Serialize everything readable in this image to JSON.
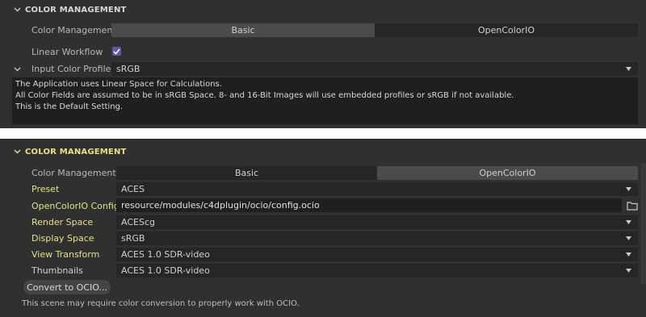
{
  "top_panel": {
    "title": "COLOR MANAGEMENT",
    "color_management_label": "Color Management",
    "modes": [
      "Basic",
      "OpenColorIO"
    ],
    "active_mode": "Basic",
    "linear_workflow_label": "Linear Workflow",
    "linear_workflow_checked": true,
    "input_profile_label": "Input Color Profile",
    "input_profile_value": "sRGB",
    "description": [
      "The Application uses Linear Space for Calculations.",
      "All Color Fields are assumed to be in sRGB Space. 8- and 16-Bit Images will use embedded profiles or sRGB if not available.",
      "This is the Default Setting."
    ]
  },
  "bottom_panel": {
    "title": "COLOR MANAGEMENT",
    "color_management_label": "Color Management",
    "modes": [
      "Basic",
      "OpenColorIO"
    ],
    "active_mode": "OpenColorIO",
    "preset_label": "Preset",
    "preset_value": "ACES",
    "config_label": "OpenColorIO Config",
    "config_value": "resource/modules/c4dplugin/ocio/config.ocio",
    "render_space_label": "Render Space",
    "render_space_value": "ACEScg",
    "display_space_label": "Display Space",
    "display_space_value": "sRGB",
    "view_transform_label": "View Transform",
    "view_transform_value": "ACES 1.0 SDR-video",
    "thumbnails_label": "Thumbnails",
    "thumbnails_value": "ACES 1.0 SDR-video",
    "convert_button": "Convert to OCIO...",
    "note": "This scene may require color conversion to properly work with OCIO."
  },
  "colors": {
    "panel_bg": "#303030",
    "field_bg": "#262626",
    "active_segment": "#4b4b4b",
    "yellow_label": "#e6e08c",
    "checkbox": "#5a5aa8"
  },
  "icons": [
    "chevron-down-icon",
    "dropdown-arrow-icon",
    "checkmark-icon",
    "folder-icon"
  ]
}
